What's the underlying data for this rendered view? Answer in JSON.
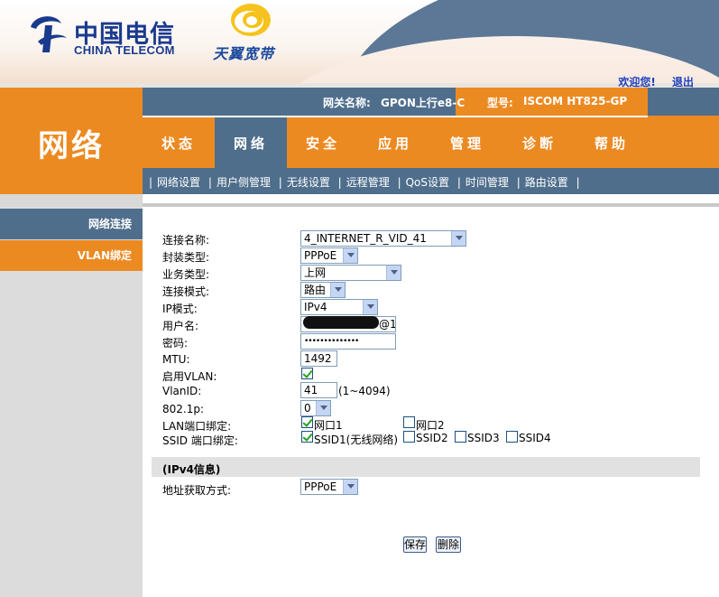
{
  "header": {
    "brand_cn": "中国电信",
    "brand_en": "CHINA TELECOM",
    "sub_brand": "天翼宽带",
    "welcome_link": "欢迎您!",
    "logout_link": "退出"
  },
  "info": {
    "gateway_label": "网关名称:",
    "gateway_value": "GPON上行e8-C",
    "model_label": "型号:",
    "model_value": "ISCOM HT825-GP"
  },
  "section_title": "网络",
  "tabs": [
    "状态",
    "网络",
    "安全",
    "应用",
    "管理",
    "诊断",
    "帮助"
  ],
  "active_tab": "网络",
  "subnav": [
    "网络设置",
    "用户侧管理",
    "无线设置",
    "远程管理",
    "QoS设置",
    "时间管理",
    "路由设置"
  ],
  "sidebar": [
    "网络连接",
    "VLAN绑定"
  ],
  "form": {
    "connection_name": {
      "label": "连接名称:",
      "value": "4_INTERNET_R_VID_41"
    },
    "encap_type": {
      "label": "封装类型:",
      "value": "PPPoE"
    },
    "service_type": {
      "label": "业务类型:",
      "value": "上网"
    },
    "conn_mode": {
      "label": "连接模式:",
      "value": "路由"
    },
    "ip_mode": {
      "label": "IP模式:",
      "value": "IPv4"
    },
    "username": {
      "label": "用户名:",
      "suffix": "@1"
    },
    "password": {
      "label": "密码:",
      "value": "••••••••••••••"
    },
    "mtu": {
      "label": "MTU:",
      "value": "1492"
    },
    "enable_vlan": {
      "label": "启用VLAN:"
    },
    "vlan_id": {
      "label": "VlanID:",
      "value": "41",
      "hint": "(1~4094)"
    },
    "dot1p": {
      "label": "802.1p:",
      "value": "0"
    },
    "lan_bind": {
      "label": "LAN端口绑定:",
      "ports": [
        "网口1",
        "网口2"
      ]
    },
    "ssid_bind": {
      "label": "SSID 端口绑定:",
      "ports": [
        "SSID1(无线网络)",
        "SSID2",
        "SSID3",
        "SSID4"
      ]
    },
    "ipv4_section": "(IPv4信息)",
    "addr_method": {
      "label": "地址获取方式:",
      "value": "PPPoE"
    }
  },
  "buttons": {
    "save": "保存",
    "delete": "删除"
  },
  "colors": {
    "orange": "#ec8a22",
    "steel_blue": "#4f6e8c",
    "brand_blue": "#1a3a8e"
  }
}
